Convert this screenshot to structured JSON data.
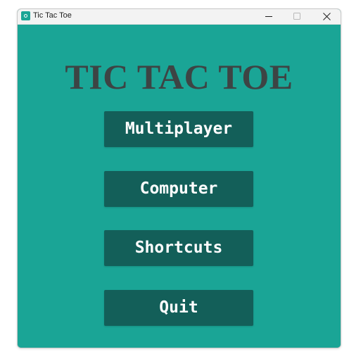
{
  "window": {
    "title": "Tic Tac Toe",
    "icon": "app-icon"
  },
  "titlebar_controls": {
    "minimize": "minimize-icon",
    "maximize": "maximize-icon",
    "close": "close-icon"
  },
  "game": {
    "title": "TIC TAC TOE"
  },
  "menu": {
    "multiplayer": "Multiplayer",
    "computer": "Computer",
    "shortcuts": "Shortcuts",
    "quit": "Quit"
  },
  "colors": {
    "background": "#1aa596",
    "button": "#135f59",
    "title_text": "#3d4444",
    "button_text": "#ffffff"
  }
}
